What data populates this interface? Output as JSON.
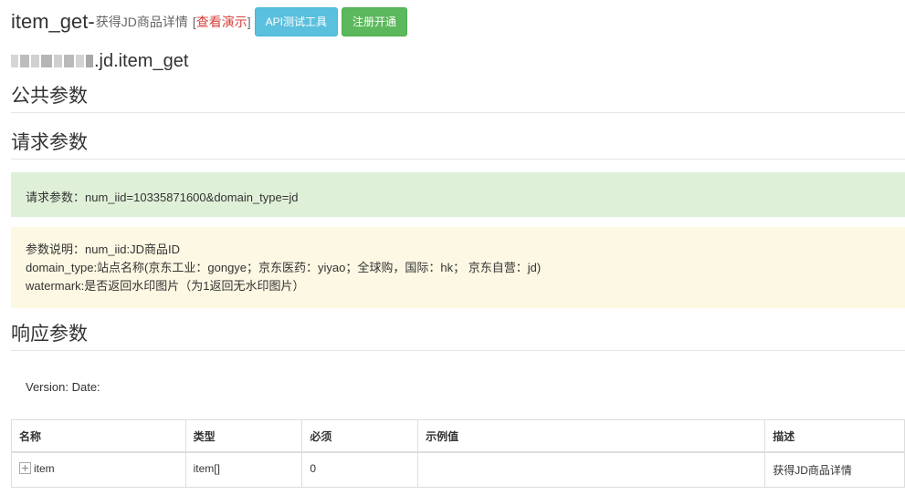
{
  "header": {
    "api_name": "item_get-",
    "api_desc": "获得JD商品详情",
    "bracket_open": "[",
    "demo_link": "查看演示",
    "bracket_close": "]",
    "api_test_button": "API测试工具",
    "register_button": "注册开通"
  },
  "method": {
    "suffix": ".jd.item_get"
  },
  "sections": {
    "public_params": "公共参数",
    "request_params": "请求参数",
    "response_params": "响应参数"
  },
  "request": {
    "text": "请求参数：num_iid=10335871600&domain_type=jd"
  },
  "explanation": {
    "line1": "参数说明：num_iid:JD商品ID",
    "line2": "domain_type:站点名称(京东工业：gongye；京东医药：yiyao；全球购，国际：hk； 京东自营：jd)",
    "line3": "watermark:是否返回水印图片（为1返回无水印图片）"
  },
  "version": "Version: Date:",
  "table": {
    "headers": [
      "名称",
      "类型",
      "必须",
      "示例值",
      "描述"
    ],
    "rows": [
      {
        "name": "item",
        "type": "item[]",
        "required": "0",
        "example": "",
        "desc": "获得JD商品详情"
      }
    ]
  },
  "colors": {
    "info_button": "#5bc0de",
    "success_button": "#5cb85c",
    "demo_link": "#d43f3a",
    "success_alert": "#dff0d8",
    "warning_alert": "#fcf8e3"
  }
}
